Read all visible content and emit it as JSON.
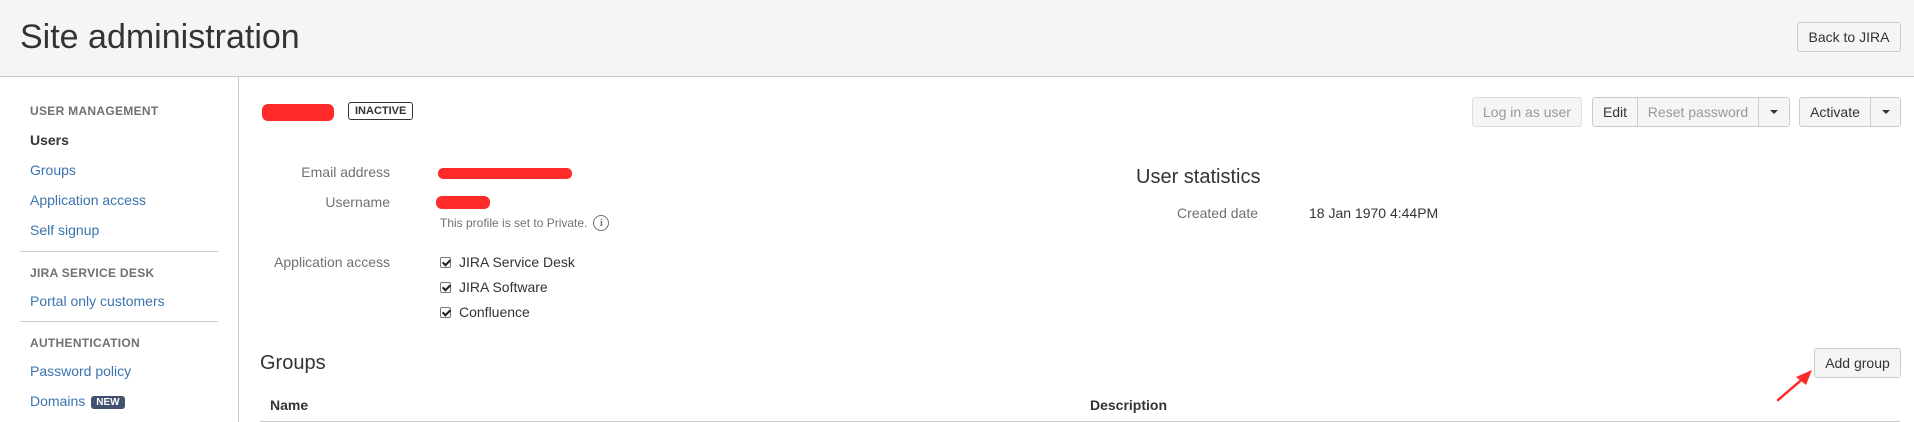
{
  "header": {
    "title": "Site administration",
    "back_label": "Back to JIRA"
  },
  "sidebar": {
    "sections": [
      {
        "heading": "USER MANAGEMENT",
        "items": [
          "Users",
          "Groups",
          "Application access",
          "Self signup"
        ]
      },
      {
        "heading": "JIRA SERVICE DESK",
        "items": [
          "Portal only customers"
        ]
      },
      {
        "heading": "AUTHENTICATION",
        "items": [
          "Password policy",
          "Domains"
        ]
      }
    ],
    "domains_badge": "NEW"
  },
  "user": {
    "status": "INACTIVE",
    "email_label": "Email address",
    "username_label": "Username",
    "privacy_note": "This profile is set to Private.",
    "app_access_label": "Application access",
    "apps": [
      "JIRA Service Desk",
      "JIRA Software",
      "Confluence"
    ]
  },
  "actions": {
    "login_as_user": "Log in as user",
    "edit": "Edit",
    "reset_password": "Reset password",
    "activate": "Activate"
  },
  "stats": {
    "title": "User statistics",
    "created_label": "Created date",
    "created_value": "18 Jan 1970 4:44PM"
  },
  "groups": {
    "title": "Groups",
    "add_label": "Add group",
    "columns": [
      "Name",
      "Description"
    ]
  },
  "colors": {
    "link": "#3b73af",
    "redaction": "#ff2a2a",
    "annotation_arrow": "#ff2a2a"
  }
}
